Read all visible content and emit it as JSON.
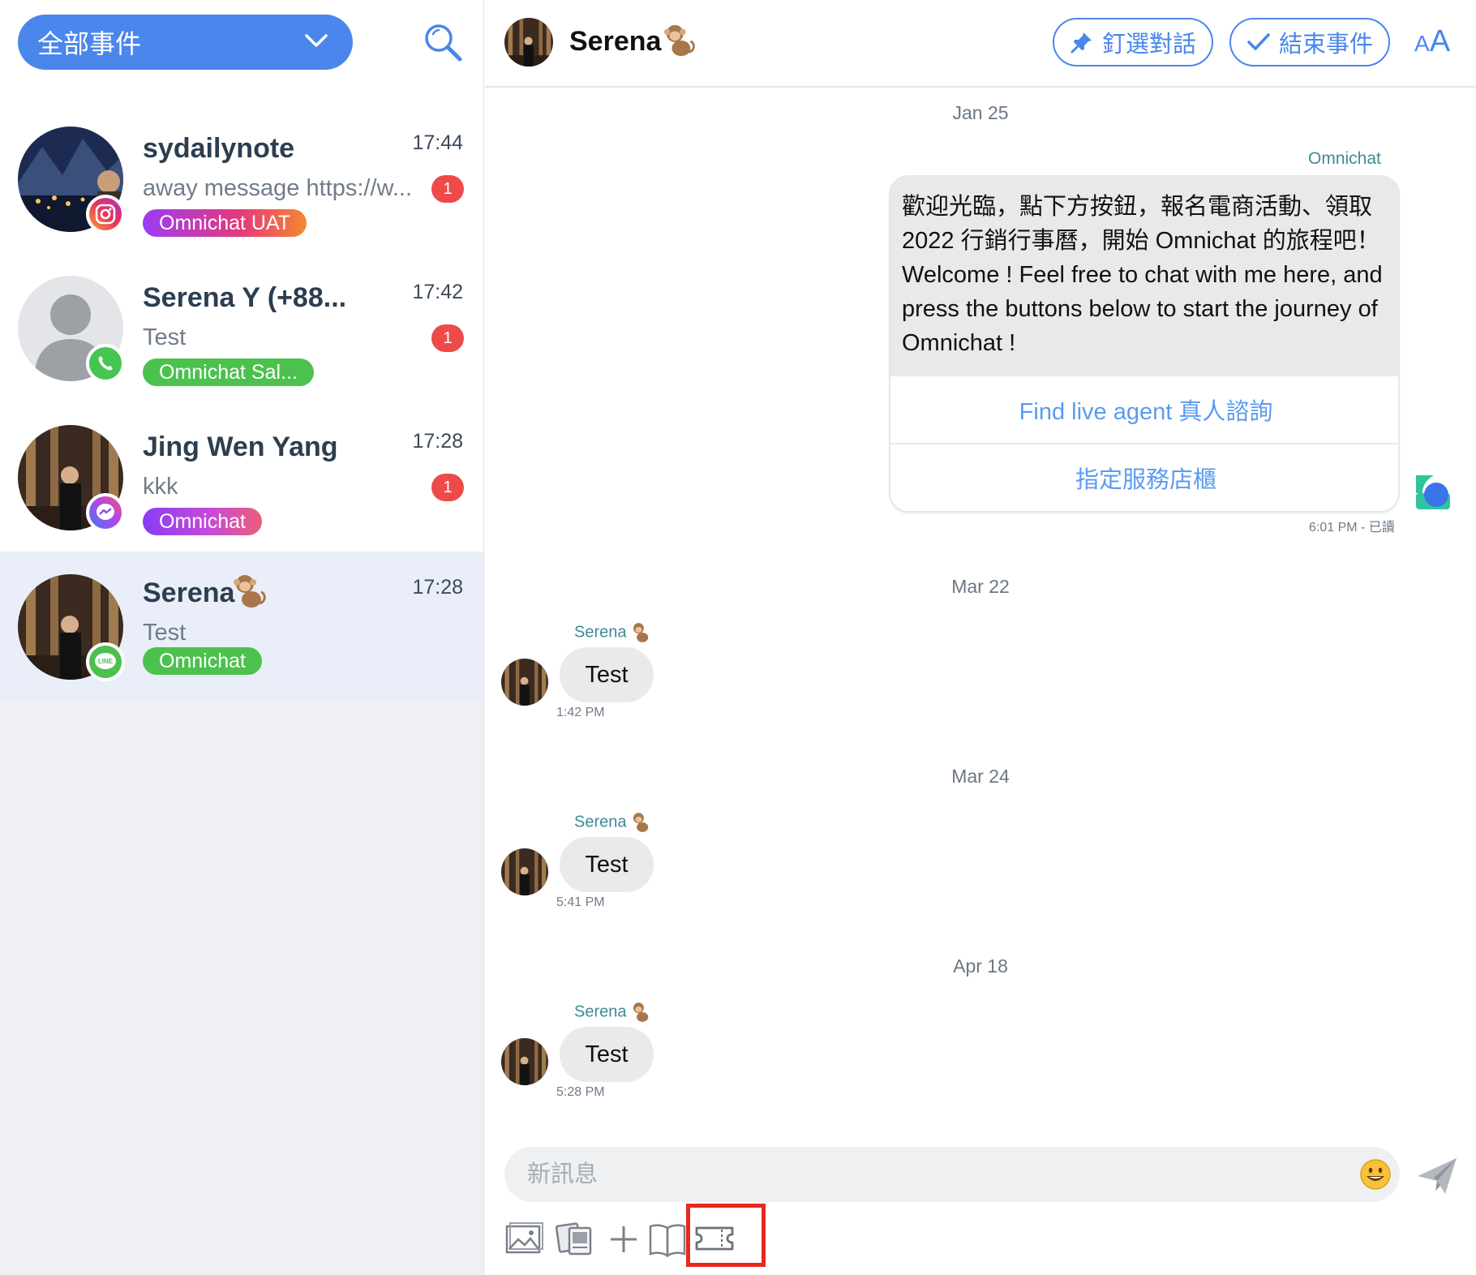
{
  "sidebar": {
    "filter": {
      "label": "全部事件"
    },
    "conversations": [
      {
        "name": "sydailynote",
        "time": "17:44",
        "preview": "away message https://w...",
        "unread": "1",
        "tag": "Omnichat UAT",
        "channel": "instagram-icon"
      },
      {
        "name": "Serena Y (+88...",
        "time": "17:42",
        "preview": "Test",
        "unread": "1",
        "tag": "Omnichat Sal...",
        "channel": "whatsapp-icon"
      },
      {
        "name": "Jing Wen Yang",
        "time": "17:28",
        "preview": "kkk",
        "unread": "1",
        "tag": "Omnichat",
        "channel": "messenger-icon"
      },
      {
        "name": "Serena",
        "time": "17:28",
        "preview": "Test",
        "unread": "",
        "tag": "Omnichat",
        "channel": "line-icon"
      }
    ]
  },
  "header": {
    "name": "Serena",
    "pin_label": "釘選對話",
    "end_label": "結束事件",
    "font_small": "A",
    "font_large": "A"
  },
  "messages": {
    "dates": [
      "Jan 25",
      "Mar 22",
      "Mar 24",
      "Apr 18"
    ],
    "bot": {
      "sender": "Omnichat",
      "text": "歡迎光臨，點下方按鈕，報名電商活動、領取 2022 行銷行事曆，開始 Omnichat 的旅程吧！ Welcome ! Feel free to chat with me here, and press the buttons below to start the journey of Omnichat !",
      "button1": "Find live agent 真人諮詢",
      "button2": "指定服務店櫃",
      "meta": "6:01 PM - 已讀"
    },
    "incoming": [
      {
        "sender": "Serena",
        "text": "Test",
        "time": "1:42 PM"
      },
      {
        "sender": "Serena",
        "text": "Test",
        "time": "5:41 PM"
      },
      {
        "sender": "Serena",
        "text": "Test",
        "time": "5:28 PM"
      }
    ]
  },
  "composer": {
    "placeholder": "新訊息"
  },
  "colors": {
    "primary": "#4a86ec",
    "unread": "#ee4a4a",
    "line_green": "#4cc14e",
    "highlight": "#e8291d"
  }
}
